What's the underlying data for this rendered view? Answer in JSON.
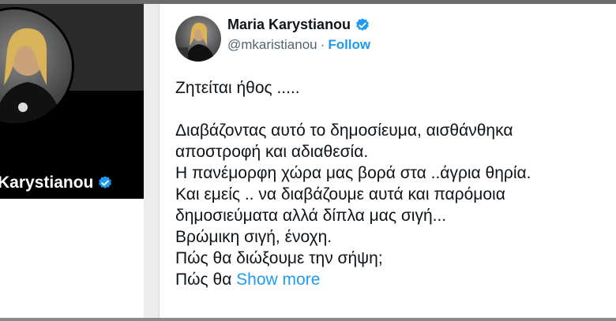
{
  "profile_card": {
    "name": "Karystianou"
  },
  "tweet": {
    "author_name": "Maria Karystianou",
    "handle": "@mkaristianou",
    "separator": "·",
    "follow_label": "Follow",
    "lines": [
      "Ζητείται ήθος .....",
      "",
      "Διαβάζοντας αυτό το δημοσίευμα, αισθάνθηκα",
      "αποστροφή και αδιαθεσία.",
      "Η πανέμορφη χώρα μας  βορά στα ..άγρια θηρία.",
      "Και εμείς ..  να διαβάζουμε αυτά και παρόμοια",
      "δημοσιεύματα αλλά  δίπλα μας σιγή...",
      "Βρώμικη σιγή, ένοχη.",
      "Πώς θα διώξουμε την σήψη;"
    ],
    "last_line_prefix": "Πώς θα ",
    "show_more_label": "Show more"
  },
  "colors": {
    "accent": "#1d9bf0",
    "text": "#0f1419",
    "muted": "#536471"
  },
  "icons": {
    "verified": "verified-badge-icon"
  }
}
